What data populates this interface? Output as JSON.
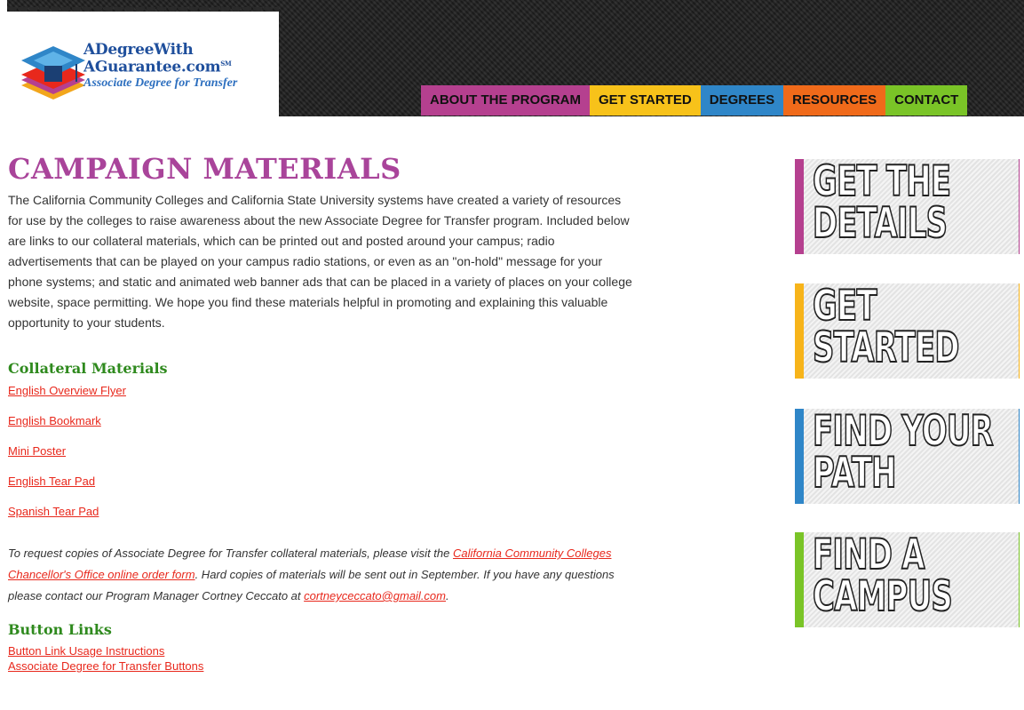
{
  "logo": {
    "line1": "ADegreeWith",
    "line2": "AGuarantee.com",
    "line2_mark": "SM",
    "line3": "Associate Degree for Transfer"
  },
  "nav": [
    {
      "label": "ABOUT THE PROGRAM",
      "color": "#b5408f"
    },
    {
      "label": "GET STARTED",
      "color": "#f7c21a"
    },
    {
      "label": "DEGREES",
      "color": "#2f86c8"
    },
    {
      "label": "RESOURCES",
      "color": "#f06a1a"
    },
    {
      "label": "CONTACT",
      "color": "#7ac427"
    }
  ],
  "main": {
    "title": "CAMPAIGN MATERIALS",
    "intro": "The California Community Colleges and California State University systems have created a variety of resources for use by the colleges to raise awareness about the new Associate Degree for Transfer program. Included below are links to our collateral materials, which can be printed out and posted around your campus; radio advertisements that can be played on your campus radio stations, or even as an \"on-hold\" message for your phone systems; and static and animated web banner ads that can be placed in a variety of places on your college website, space permitting. We hope you find these materials helpful in promoting and explaining this valuable opportunity to your students.",
    "collateral_heading": "Collateral Materials",
    "collateral_links": [
      "English Overview Flyer",
      "English Bookmark",
      "Mini Poster",
      "English Tear Pad",
      "Spanish Tear Pad"
    ],
    "note_part1": "To request copies of Associate Degree for Transfer collateral materials, please visit the ",
    "note_link": "California Community Colleges Chancellor's Office online order form",
    "note_part2": ". Hard copies of materials will be sent out in September. If you have any questions please contact our Program Manager Cortney Ceccato at ",
    "note_email": "cortneyceccato@gmail.com",
    "note_part3": ".",
    "button_heading": "Button Links",
    "button_links": [
      "Button Link Usage Instructions",
      "Associate Degree for Transfer Buttons"
    ]
  },
  "sidebar": [
    {
      "line1": "GET THE",
      "line2": "DETAILS",
      "color": "#b5408f"
    },
    {
      "line1": "GET",
      "line2": "STARTED",
      "color": "#f7b41a"
    },
    {
      "line1": "FIND YOUR",
      "line2": "PATH",
      "color": "#2f86c8"
    },
    {
      "line1": "FIND A",
      "line2": "CAMPUS",
      "color": "#7ac427"
    }
  ]
}
